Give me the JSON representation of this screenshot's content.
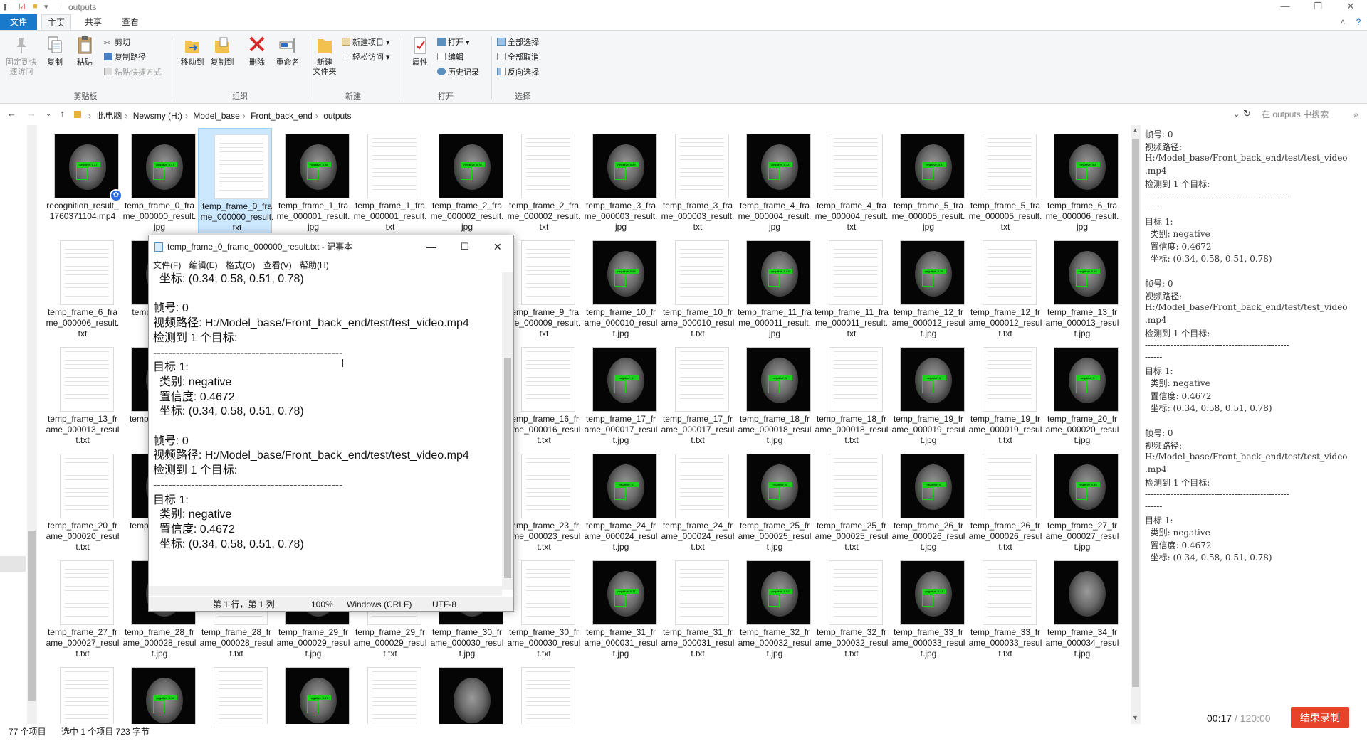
{
  "window": {
    "title": "outputs",
    "min": "—",
    "max": "❐",
    "close": "✕"
  },
  "tabs": {
    "file": "文件",
    "home": "主页",
    "share": "共享",
    "view": "查看"
  },
  "ribbon": {
    "pin": [
      "固定到快",
      "速访问"
    ],
    "copy": "复制",
    "paste": "粘贴",
    "cut": "剪切",
    "copy_path": "复制路径",
    "paste_shortcut": "粘贴快捷方式",
    "move_to": "移动到",
    "copy_to": "复制到",
    "delete": "删除",
    "rename": "重命名",
    "new_folder": [
      "新建",
      "文件夹"
    ],
    "new_item": "新建项目",
    "easy_access": "轻松访问",
    "properties": "属性",
    "open": "打开",
    "edit": "编辑",
    "history": "历史记录",
    "select_all": "全部选择",
    "select_none": "全部取消",
    "invert": "反向选择",
    "group_clipboard": "剪贴板",
    "group_organize": "组织",
    "group_new": "新建",
    "group_open": "打开",
    "group_select": "选择"
  },
  "address": {
    "crumbs": [
      "此电脑",
      "Newsmy (H:)",
      "Model_base",
      "Front_back_end",
      "outputs"
    ],
    "search_placeholder": "在 outputs 中搜索"
  },
  "files": [
    {
      "name": "recognition_result_1760371104.mp4",
      "type": "vid",
      "label": "negative: 0.47"
    },
    {
      "name": "temp_frame_0_frame_000000_result.jpg",
      "type": "img",
      "label": "negative: 0.47"
    },
    {
      "name": "temp_frame_0_frame_000000_result.txt",
      "type": "txt"
    },
    {
      "name": "temp_frame_1_frame_000001_result.jpg",
      "type": "img",
      "label": "negative: 0.46"
    },
    {
      "name": "temp_frame_1_frame_000001_result.txt",
      "type": "txt"
    },
    {
      "name": "temp_frame_2_frame_000002_result.jpg",
      "type": "img",
      "label": "negative: 0.78"
    },
    {
      "name": "temp_frame_2_frame_000002_result.txt",
      "type": "txt"
    },
    {
      "name": "temp_frame_3_frame_000003_result.jpg",
      "type": "img",
      "label": "negative: 0.49"
    },
    {
      "name": "temp_frame_3_frame_000003_result.txt",
      "type": "txt"
    },
    {
      "name": "temp_frame_4_frame_000004_result.jpg",
      "type": "img",
      "label": "negative: 0.44"
    },
    {
      "name": "temp_frame_4_frame_000004_result.txt",
      "type": "txt"
    },
    {
      "name": "temp_frame_5_frame_000005_result.jpg",
      "type": "img",
      "label": "negative: 0.4"
    },
    {
      "name": "temp_frame_5_frame_000005_result.txt",
      "type": "txt"
    },
    {
      "name": "temp_frame_6_frame_000006_result.jpg",
      "type": "img",
      "label": "negative: 0.4"
    },
    {
      "name": "temp_frame_6_frame_000006_result.txt",
      "type": "txt"
    },
    {
      "name": "temp_frame_7",
      "type": "img",
      "label": ""
    },
    {
      "name": "",
      "type": "hidden"
    },
    {
      "name": "",
      "type": "hidden"
    },
    {
      "name": "",
      "type": "hidden"
    },
    {
      "name": "",
      "type": "hidden"
    },
    {
      "name": "temp_frame_9_frame_000009_result.txt",
      "type": "txt"
    },
    {
      "name": "temp_frame_10_frame_000010_result.jpg",
      "type": "img",
      "label": "negative: 0.56"
    },
    {
      "name": "temp_frame_10_frame_000010_result.txt",
      "type": "txt"
    },
    {
      "name": "temp_frame_11_frame_000011_result.jpg",
      "type": "img",
      "label": "negative: 0.83"
    },
    {
      "name": "temp_frame_11_frame_000011_result.txt",
      "type": "txt"
    },
    {
      "name": "temp_frame_12_frame_000012_result.jpg",
      "type": "img",
      "label": "negative: 0.75"
    },
    {
      "name": "temp_frame_12_frame_000012_result.txt",
      "type": "txt"
    },
    {
      "name": "temp_frame_13_frame_000013_result.jpg",
      "type": "img",
      "label": "negative: 0.62"
    },
    {
      "name": "temp_frame_13_frame_000013_result.txt",
      "type": "txt"
    },
    {
      "name": "temp_frame_14",
      "type": "img",
      "label": ""
    },
    {
      "name": "",
      "type": "hidden"
    },
    {
      "name": "",
      "type": "hidden"
    },
    {
      "name": "",
      "type": "hidden"
    },
    {
      "name": "",
      "type": "hidden"
    },
    {
      "name": "temp_frame_16_frame_000016_result.txt",
      "type": "txt"
    },
    {
      "name": "temp_frame_17_frame_000017_result.jpg",
      "type": "img",
      "label": "negative: 0."
    },
    {
      "name": "temp_frame_17_frame_000017_result.txt",
      "type": "txt"
    },
    {
      "name": "temp_frame_18_frame_000018_result.jpg",
      "type": "img",
      "label": "negative: 0."
    },
    {
      "name": "temp_frame_18_frame_000018_result.txt",
      "type": "txt"
    },
    {
      "name": "temp_frame_19_frame_000019_result.jpg",
      "type": "img",
      "label": "negative: 0."
    },
    {
      "name": "temp_frame_19_frame_000019_result.txt",
      "type": "txt"
    },
    {
      "name": "temp_frame_20_frame_000020_result.jpg",
      "type": "img",
      "label": "negative: 0."
    },
    {
      "name": "temp_frame_20_frame_000020_result.txt",
      "type": "txt"
    },
    {
      "name": "temp_frame_21",
      "type": "img",
      "label": ""
    },
    {
      "name": "",
      "type": "hidden"
    },
    {
      "name": "",
      "type": "hidden"
    },
    {
      "name": "",
      "type": "hidden"
    },
    {
      "name": "",
      "type": "hidden"
    },
    {
      "name": "temp_frame_23_frame_000023_result.txt",
      "type": "txt"
    },
    {
      "name": "temp_frame_24_frame_000024_result.jpg",
      "type": "img",
      "label": "negative: 0."
    },
    {
      "name": "temp_frame_24_frame_000024_result.txt",
      "type": "txt"
    },
    {
      "name": "temp_frame_25_frame_000025_result.jpg",
      "type": "img",
      "label": "negative: 0."
    },
    {
      "name": "temp_frame_25_frame_000025_result.txt",
      "type": "txt"
    },
    {
      "name": "temp_frame_26_frame_000026_result.jpg",
      "type": "img",
      "label": "negative: 0."
    },
    {
      "name": "temp_frame_26_frame_000026_result.txt",
      "type": "txt"
    },
    {
      "name": "temp_frame_27_frame_000027_result.jpg",
      "type": "img",
      "label": "negative: 0.49"
    },
    {
      "name": "temp_frame_27_frame_000027_result.txt",
      "type": "txt"
    },
    {
      "name": "temp_frame_28_frame_000028_result.jpg",
      "type": "img",
      "label": ""
    },
    {
      "name": "temp_frame_28_frame_000028_result.txt",
      "type": "txt"
    },
    {
      "name": "temp_frame_29_frame_000029_result.jpg",
      "type": "img",
      "label": ""
    },
    {
      "name": "temp_frame_29_frame_000029_result.txt",
      "type": "txt"
    },
    {
      "name": "temp_frame_30_frame_000030_result.jpg",
      "type": "img",
      "label": ""
    },
    {
      "name": "temp_frame_30_frame_000030_result.txt",
      "type": "txt"
    },
    {
      "name": "temp_frame_31_frame_000031_result.jpg",
      "type": "img",
      "label": "negative: 0.77"
    },
    {
      "name": "temp_frame_31_frame_000031_result.txt",
      "type": "txt"
    },
    {
      "name": "temp_frame_32_frame_000032_result.jpg",
      "type": "img",
      "label": "negative: 0.52"
    },
    {
      "name": "temp_frame_32_frame_000032_result.txt",
      "type": "txt"
    },
    {
      "name": "temp_frame_33_frame_000033_result.jpg",
      "type": "img",
      "label": "negative: 0.43"
    },
    {
      "name": "temp_frame_33_frame_000033_result.txt",
      "type": "txt"
    },
    {
      "name": "temp_frame_34_frame_000034_result.jpg",
      "type": "img",
      "label": ""
    },
    {
      "name": "",
      "type": "txt"
    },
    {
      "name": "",
      "type": "img",
      "label": "negative: 0.38"
    },
    {
      "name": "",
      "type": "txt"
    },
    {
      "name": "",
      "type": "img",
      "label": "negative: 0.37"
    },
    {
      "name": "",
      "type": "txt"
    },
    {
      "name": "",
      "type": "img",
      "label": ""
    },
    {
      "name": "",
      "type": "txt"
    }
  ],
  "notepad": {
    "title": "temp_frame_0_frame_000000_result.txt - 记事本",
    "menu": [
      "文件(F)",
      "编辑(E)",
      "格式(O)",
      "查看(V)",
      "帮助(H)"
    ],
    "lines": [
      "  坐标: (0.34, 0.58, 0.51, 0.78)",
      "",
      "帧号: 0",
      "视频路径: H:/Model_base/Front_back_end/test/test_video.mp4",
      "检测到 1 个目标:",
      "--------------------------------------------------",
      "目标 1:",
      "  类别: negative",
      "  置信度: 0.4672",
      "  坐标: (0.34, 0.58, 0.51, 0.78)",
      "",
      "帧号: 0",
      "视频路径: H:/Model_base/Front_back_end/test/test_video.mp4",
      "检测到 1 个目标:",
      "--------------------------------------------------",
      "目标 1:",
      "  类别: negative",
      "  置信度: 0.4672",
      "  坐标: (0.34, 0.58, 0.51, 0.78)"
    ],
    "status": {
      "pos": "第 1 行，第 1 列",
      "zoom": "100%",
      "eol": "Windows (CRLF)",
      "enc": "UTF-8"
    }
  },
  "preview": {
    "lines": [
      "帧号: 0",
      "视频路径:",
      "H:/Model_base/Front_back_end/test/test_video",
      ".mp4",
      "检测到 1 个目标:",
      "--------------------------------------------------",
      "------",
      "目标 1:",
      "  类别: negative",
      "  置信度: 0.4672",
      "  坐标: (0.34, 0.58, 0.51, 0.78)",
      "",
      "帧号: 0",
      "视频路径:",
      "H:/Model_base/Front_back_end/test/test_video",
      ".mp4",
      "检测到 1 个目标:",
      "--------------------------------------------------",
      "------",
      "目标 1:",
      "  类别: negative",
      "  置信度: 0.4672",
      "  坐标: (0.34, 0.58, 0.51, 0.78)",
      "",
      "帧号: 0",
      "视频路径:",
      "H:/Model_base/Front_back_end/test/test_video",
      ".mp4",
      "检测到 1 个目标:",
      "--------------------------------------------------",
      "------",
      "目标 1:",
      "  类别: negative",
      "  置信度: 0.4672",
      "  坐标: (0.34, 0.58, 0.51, 0.78)"
    ]
  },
  "status": {
    "count": "77 个项目",
    "selected": "选中 1 个项目  723 字节"
  },
  "recorder": {
    "time": "00:17",
    "total": "/ 120:00",
    "stop": "结束录制"
  },
  "colors": {
    "accent": "#1979ca",
    "detect_box": "#1cd31c",
    "record_button": "#e8432a"
  }
}
